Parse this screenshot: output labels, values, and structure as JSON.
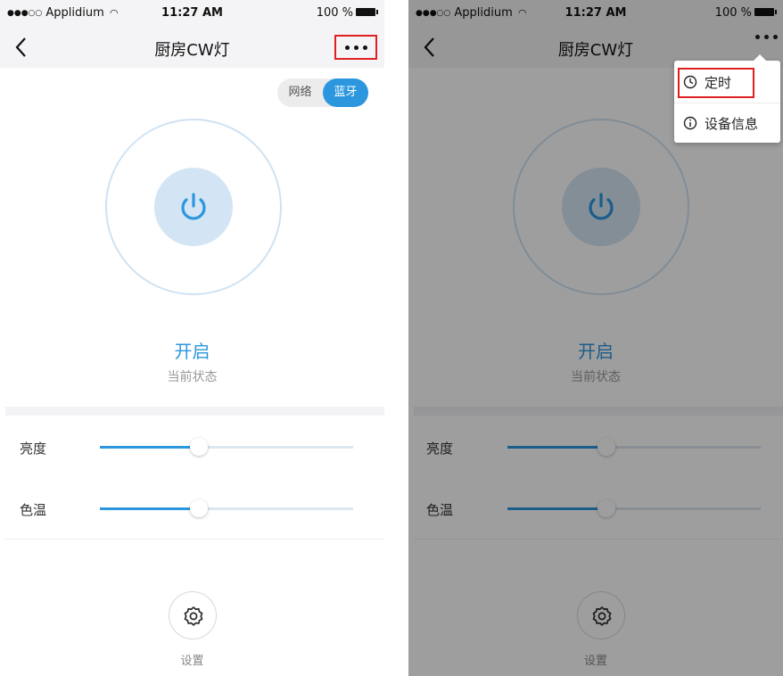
{
  "status_bar": {
    "carrier": "Applidium",
    "signal_dots": "●●●○○",
    "wifi_icon": "wifi-icon",
    "time": "11:27 AM",
    "battery": "100 %"
  },
  "nav": {
    "title": "厨房CW灯",
    "back_icon": "chevron-left-icon",
    "more_icon": "more-horizontal-icon"
  },
  "connection_toggle": {
    "options": [
      "网络",
      "蓝牙"
    ],
    "selected": "蓝牙"
  },
  "power": {
    "icon": "power-icon",
    "state": "开启",
    "state_label": "当前状态"
  },
  "sliders": [
    {
      "label": "亮度",
      "value_fraction": 0.39
    },
    {
      "label": "色温",
      "value_fraction": 0.39
    }
  ],
  "settings": {
    "icon": "gear-icon",
    "label": "设置"
  },
  "menu": {
    "items": [
      {
        "label": "定时",
        "icon": "clock-icon"
      },
      {
        "label": "设备信息",
        "icon": "info-icon"
      }
    ]
  },
  "colors": {
    "accent": "#2c97de",
    "highlight": "#e02020"
  }
}
